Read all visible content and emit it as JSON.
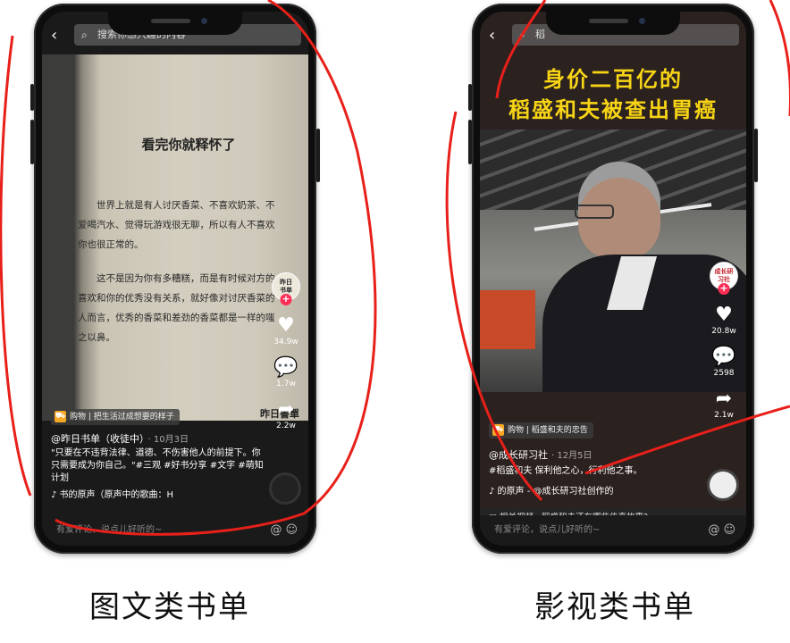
{
  "left_phone": {
    "search_placeholder": "搜索你感兴趣的内容",
    "page_title": "看完你就释怀了",
    "paragraph1": "世界上就是有人讨厌香菜、不喜欢奶茶、不爱喝汽水、觉得玩游戏很无聊，所以有人不喜欢你也很正常的。",
    "paragraph2": "这不是因为你有多糟糕，而是有时候对方的喜欢和你的优秀没有关系，就好像对讨厌香菜的人而言，优秀的香菜和差劲的香菜都是一样的嗤之以鼻。",
    "avatar_text": "昨日书单",
    "likes": "34.9w",
    "comments": "1.7w",
    "shares": "2.2w",
    "watermark": "昨日書單",
    "shop_label": "购物",
    "shop_text": "把生活过成想要的样子",
    "author": "@昨日书单（收徒中）",
    "date": "· 10月3日",
    "description": "\"只要在不违背法律、道德、不伤害他人的前提下。你只需要成为你自己。\"#三观 #好书分享 #文字 #萌知计划",
    "music": "♪ 书的原声（原声中的歌曲：H",
    "comment_placeholder": "有爱评论，说点儿好听的~",
    "comment_icons": "@ ☺"
  },
  "right_phone": {
    "search_placeholder": "稻",
    "video_title_line1": "身价二百亿的",
    "video_title_line2": "稻盛和夫被查出胃癌",
    "avatar_text": "成长研习社",
    "likes": "20.8w",
    "comments": "2598",
    "shares": "2.1w",
    "shop_label": "购物",
    "shop_text": "稻盛和夫的忠告",
    "author": "@成长研习社",
    "date": "· 12月5日",
    "description": "#稻盛和夫 保利他之心，行利他之事。",
    "music": "♪ 的原声 - @成长研习社创作的",
    "related": "相关视频 · 稻盛和夫还有哪些传奇故事?",
    "comment_placeholder": "有爱评论，说点儿好听的~",
    "comment_icons": "@ ☺"
  },
  "captions": {
    "left": "图文类书单",
    "right": "影视类书单"
  },
  "colors": {
    "annotation_red": "#e8201a",
    "like_pink": "#fe2c55",
    "title_yellow": "#f7d416",
    "cart_orange": "#f5a623"
  }
}
